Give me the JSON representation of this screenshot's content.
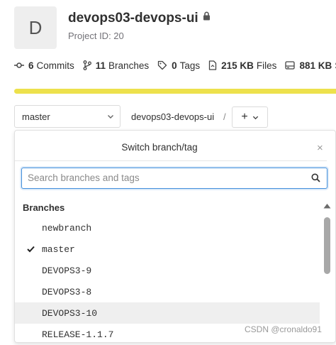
{
  "project": {
    "avatar_letter": "D",
    "name": "devops03-devops-ui",
    "id_text": "Project ID: 20"
  },
  "stats": [
    {
      "icon": "commit-icon",
      "count": "6",
      "label": "Commits"
    },
    {
      "icon": "branch-icon",
      "count": "11",
      "label": "Branches"
    },
    {
      "icon": "tag-icon",
      "count": "0",
      "label": "Tags"
    },
    {
      "icon": "file-icon",
      "count": "215 KB",
      "label": "Files"
    },
    {
      "icon": "storage-icon",
      "count": "881 KB",
      "label": "St"
    }
  ],
  "repo_nav": {
    "current_branch": "master",
    "path_crumb": "devops03-devops-ui",
    "separator": "/",
    "add_symbol": "+"
  },
  "dropdown": {
    "title": "Switch branch/tag",
    "close_symbol": "×",
    "search_placeholder": "Search branches and tags",
    "section_label": "Branches",
    "branches": [
      {
        "name": "newbranch",
        "selected": false,
        "highlighted": false
      },
      {
        "name": "master",
        "selected": true,
        "highlighted": false
      },
      {
        "name": "DEVOPS3-9",
        "selected": false,
        "highlighted": false
      },
      {
        "name": "DEVOPS3-8",
        "selected": false,
        "highlighted": false
      },
      {
        "name": "DEVOPS3-10",
        "selected": false,
        "highlighted": true
      },
      {
        "name": "RELEASE-1.1.7",
        "selected": false,
        "highlighted": false
      }
    ]
  },
  "watermark": "CSDN @cronaldo91",
  "colors": {
    "accent": "#428fdc",
    "progress": "#ede14c",
    "highlight_row": "#efefef"
  }
}
